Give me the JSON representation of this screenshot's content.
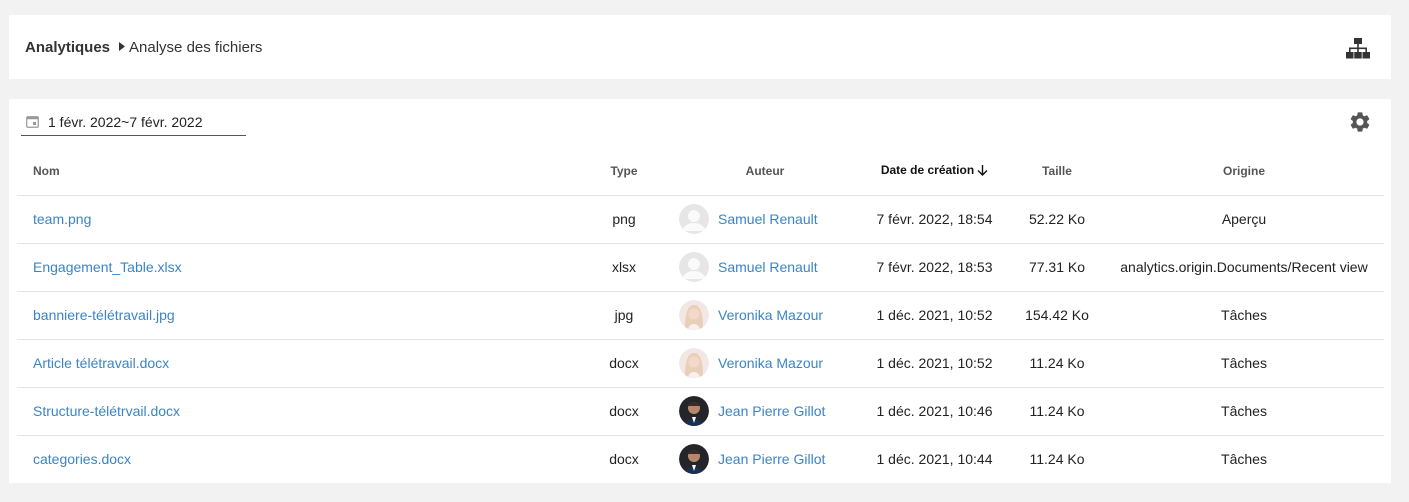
{
  "breadcrumb": {
    "root": "Analytiques",
    "separator_icon": "caret-right-icon",
    "current": "Analyse des fichiers"
  },
  "header_actions": {
    "icon": "sitemap-icon"
  },
  "filters": {
    "date_range": "1 févr. 2022~7 févr. 2022",
    "date_icon": "calendar-icon",
    "settings_icon": "gear-icon"
  },
  "table": {
    "columns": {
      "name": "Nom",
      "type": "Type",
      "author": "Auteur",
      "created": "Date de création",
      "size": "Taille",
      "origin": "Origine"
    },
    "sort_column": "created",
    "sort_direction": "desc",
    "rows": [
      {
        "name": "team.png",
        "type": "png",
        "author": "Samuel Renault",
        "avatar": "placeholder",
        "created": "7 févr. 2022, 18:54",
        "size": "52.22 Ko",
        "origin": "Aperçu"
      },
      {
        "name": "Engagement_Table.xlsx",
        "type": "xlsx",
        "author": "Samuel Renault",
        "avatar": "placeholder",
        "created": "7 févr. 2022, 18:53",
        "size": "77.31 Ko",
        "origin": "analytics.origin.Documents/Recent view"
      },
      {
        "name": "banniere-télétravail.jpg",
        "type": "jpg",
        "author": "Veronika Mazour",
        "avatar": "photo-light",
        "created": "1 déc. 2021, 10:52",
        "size": "154.42 Ko",
        "origin": "Tâches"
      },
      {
        "name": "Article télétravail.docx",
        "type": "docx",
        "author": "Veronika Mazour",
        "avatar": "photo-light",
        "created": "1 déc. 2021, 10:52",
        "size": "11.24 Ko",
        "origin": "Tâches"
      },
      {
        "name": "Structure-télétrvail.docx",
        "type": "docx",
        "author": "Jean Pierre Gillot",
        "avatar": "photo-dark",
        "created": "1 déc. 2021, 10:46",
        "size": "11.24 Ko",
        "origin": "Tâches"
      },
      {
        "name": "categories.docx",
        "type": "docx",
        "author": "Jean Pierre Gillot",
        "avatar": "photo-dark",
        "created": "1 déc. 2021, 10:44",
        "size": "11.24 Ko",
        "origin": "Tâches"
      }
    ]
  },
  "colors": {
    "link": "#3b84c6",
    "background": "#f2f2f2",
    "card": "#ffffff",
    "divider": "#e3e3e3"
  }
}
